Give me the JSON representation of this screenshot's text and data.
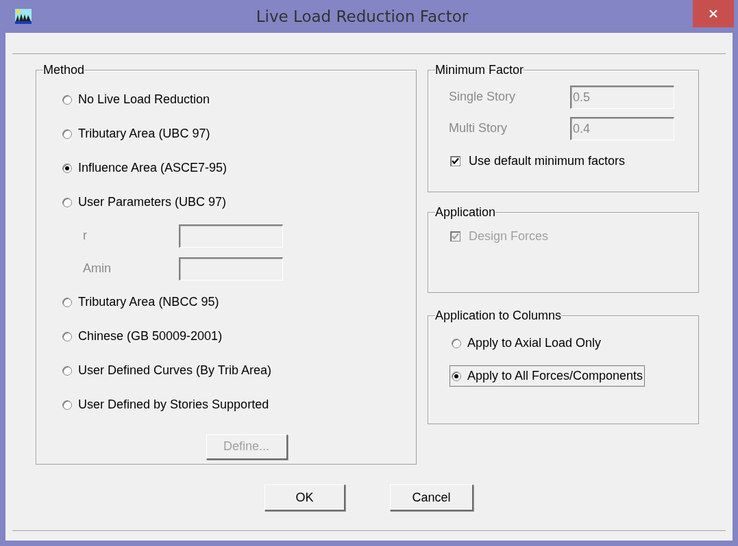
{
  "window": {
    "title": "Live Load Reduction Factor"
  },
  "method": {
    "title": "Method",
    "options": [
      {
        "label": "No Live Load Reduction",
        "selected": false
      },
      {
        "label": "Tributary Area (UBC 97)",
        "selected": false
      },
      {
        "label": "Influence Area (ASCE7-95)",
        "selected": true
      },
      {
        "label": "User Parameters (UBC 97)",
        "selected": false,
        "fields": [
          {
            "label": "r",
            "disabled": true
          },
          {
            "label": "Amin",
            "disabled": true
          }
        ]
      },
      {
        "label": "Tributary Area (NBCC 95)",
        "selected": false
      },
      {
        "label": "Chinese (GB 50009-2001)",
        "selected": false
      },
      {
        "label": "User Defined Curves (By Trib Area)",
        "selected": false
      },
      {
        "label": "User Defined by Stories Supported",
        "selected": false
      }
    ],
    "define_button": {
      "label": "Define...",
      "disabled": true
    }
  },
  "minimum_factor": {
    "title": "Minimum Factor",
    "fields": [
      {
        "label": "Single Story",
        "value": "0.5",
        "disabled": true
      },
      {
        "label": "Multi Story",
        "value": "0.4",
        "disabled": true
      }
    ],
    "checkbox": {
      "label": "Use default minimum factors",
      "checked": true,
      "disabled": false
    }
  },
  "application": {
    "title": "Application",
    "checkbox": {
      "label": "Design Forces",
      "checked": true,
      "disabled": true
    }
  },
  "application_to_columns": {
    "title": "Application to Columns",
    "options": [
      {
        "label": "Apply to Axial Load Only",
        "selected": false,
        "focused": false
      },
      {
        "label": "Apply to All Forces/Components",
        "selected": true,
        "focused": true
      }
    ]
  },
  "buttons": [
    {
      "label": "OK"
    },
    {
      "label": "Cancel"
    }
  ]
}
